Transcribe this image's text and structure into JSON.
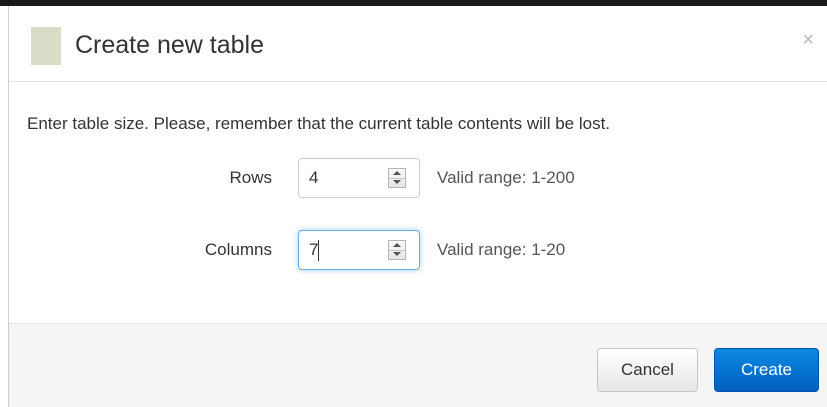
{
  "dialog": {
    "title": "Create new table",
    "close_label": "×",
    "message": "Enter table size. Please, remember that the current table contents will be lost.",
    "fields": [
      {
        "label": "Rows",
        "value": "4",
        "hint": "Valid range: 1-200"
      },
      {
        "label": "Columns",
        "value": "7",
        "hint": "Valid range: 1-20"
      }
    ],
    "buttons": {
      "cancel": "Cancel",
      "create": "Create"
    }
  },
  "colors": {
    "primary": "#0a7ad6",
    "header_swatch": "#d9dcc7",
    "footer_bg": "#f5f5f5",
    "focus_border": "#66afe9"
  },
  "icons": {
    "close": "close-icon",
    "stepper": "spinner-arrows-icon"
  }
}
